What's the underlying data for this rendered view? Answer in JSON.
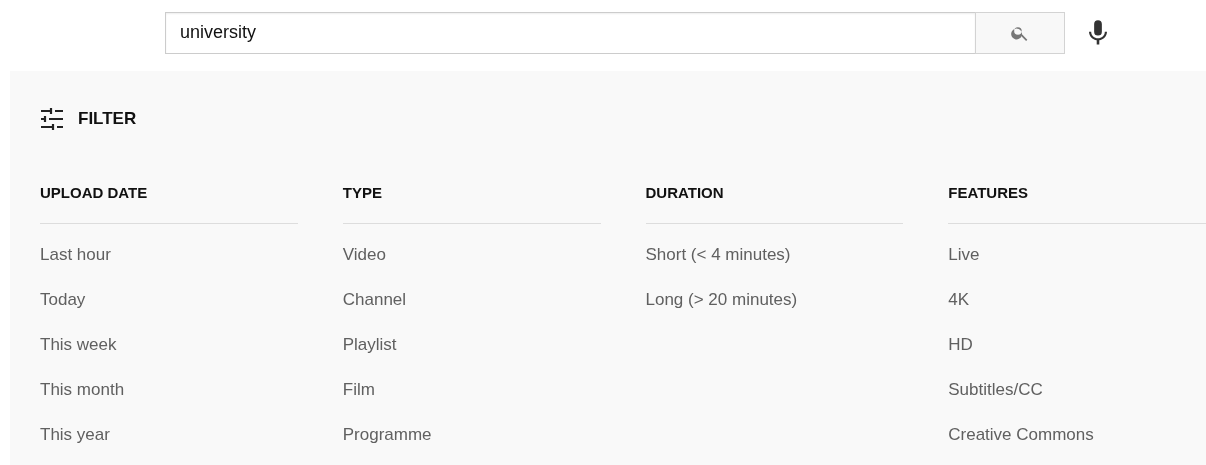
{
  "search": {
    "value": "university"
  },
  "filter": {
    "label": "FILTER"
  },
  "groups": [
    {
      "title": "UPLOAD DATE",
      "options": [
        "Last hour",
        "Today",
        "This week",
        "This month",
        "This year"
      ]
    },
    {
      "title": "TYPE",
      "options": [
        "Video",
        "Channel",
        "Playlist",
        "Film",
        "Programme"
      ]
    },
    {
      "title": "DURATION",
      "options": [
        "Short (< 4 minutes)",
        "Long (> 20 minutes)"
      ]
    },
    {
      "title": "FEATURES",
      "options": [
        "Live",
        "4K",
        "HD",
        "Subtitles/CC",
        "Creative Commons"
      ]
    }
  ]
}
